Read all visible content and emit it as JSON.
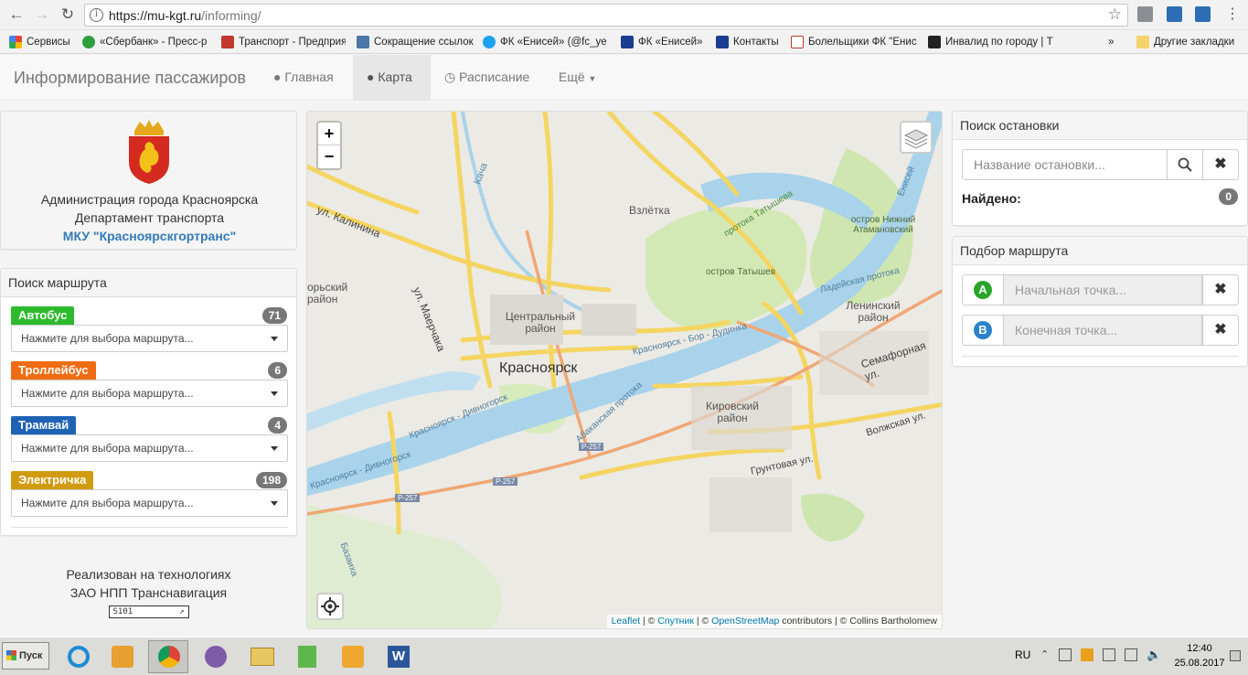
{
  "browser": {
    "url_domain": "https://mu-kgt.ru",
    "url_path": "/informing/",
    "bookmarks": [
      {
        "label": "Сервисы",
        "color": "#4285f4"
      },
      {
        "label": "«Сбербанк» - Пресс-р",
        "color": "#2e9e3e"
      },
      {
        "label": "Транспорт - Предприя",
        "color": "#c0392b"
      },
      {
        "label": "Сокращение ссылок",
        "color": "#4a76a8"
      },
      {
        "label": "ФК «Енисей» (@fc_ye",
        "color": "#1da1f2"
      },
      {
        "label": "ФК «Енисей»",
        "color": "#1a3d8f"
      },
      {
        "label": "Контакты",
        "color": "#1a3d8f"
      },
      {
        "label": "Болельщики ФК \"Енис",
        "color": "#c0392b"
      },
      {
        "label": "Инвалид по городу | Т",
        "color": "#222222"
      }
    ],
    "more": "»",
    "other_bookmarks": "Другие закладки"
  },
  "app": {
    "brand": "Информирование пассажиров",
    "nav": [
      {
        "label": "Главная",
        "icon": "globe-icon"
      },
      {
        "label": "Карта",
        "icon": "map-marker-icon"
      },
      {
        "label": "Расписание",
        "icon": "clock-icon"
      },
      {
        "label": "Ещё",
        "icon": "caret-down-icon"
      }
    ]
  },
  "admin": {
    "line1": "Администрация города Красноярска",
    "line2": "Департамент транспорта",
    "mku": "МКУ \"Красноярскгортранс\""
  },
  "route_search": {
    "title": "Поиск маршрута",
    "types": [
      {
        "label": "Автобус",
        "count": "71",
        "color": "#2dbb2d",
        "placeholder": "Нажмите для выбора маршрута..."
      },
      {
        "label": "Троллейбус",
        "count": "6",
        "color": "#ef6c12",
        "placeholder": "Нажмите для выбора маршрута..."
      },
      {
        "label": "Трамвай",
        "count": "4",
        "color": "#1f63b5",
        "placeholder": "Нажмите для выбора маршрута..."
      },
      {
        "label": "Электричка",
        "count": "198",
        "color": "#d19b10",
        "placeholder": "Нажмите для выбора маршрута..."
      }
    ]
  },
  "footer": {
    "line1": "Реализован на технологиях",
    "line2": "ЗАО НПП Транснавигация",
    "logo": "S101"
  },
  "map": {
    "zoom_in": "+",
    "zoom_out": "−",
    "labels": {
      "kalinina": "ул. Калинина",
      "maerchaka": "ул. Маерчака",
      "kacha": "Кача",
      "vzletka": "Взлётка",
      "protoka_tatysheva": "протока Татышева",
      "ostrov_atamanovsky": "остров Нижний Атамановский",
      "ostrov_tatyshev": "остров Татышев",
      "enisey": "Енисей",
      "ladeyskaya": "Ладейская протока",
      "leninsky": "Ленинский район",
      "semafornaya": "Семафорная ул.",
      "tsentralny": "Центральный район",
      "krasnoyarsk": "Красноярск",
      "bor": "Красноярск - Бор - Дудинка",
      "divnogorsk": "Красноярск - Дивногорск",
      "abakanskaya": "Абаканская протока",
      "kirovsky": "Кировский район",
      "volzhskaya": "Волжская ул.",
      "gruntovaya": "Грунтовая ул.",
      "r257": "Р-257",
      "bazaikha": "Базаиха",
      "gorky": "орьский район"
    },
    "attribution": {
      "leaflet": "Leaflet",
      "sep1": " | © ",
      "sputnik": "Спутник",
      "sep2": " | © ",
      "osm": "OpenStreetMap",
      "rest": " contributors | © Collins Bartholomew"
    }
  },
  "stop_search": {
    "title": "Поиск остановки",
    "placeholder": "Название остановки...",
    "found_label": "Найдено:",
    "found_count": "0"
  },
  "route_pick": {
    "title": "Подбор маршрута",
    "start_letter": "A",
    "start_placeholder": "Начальная точка...",
    "start_color": "#2aa52a",
    "end_letter": "B",
    "end_placeholder": "Конечная точка...",
    "end_color": "#2b82cb"
  },
  "taskbar": {
    "start": "Пуск",
    "lang": "RU",
    "time": "12:40",
    "date": "25.08.2017"
  }
}
